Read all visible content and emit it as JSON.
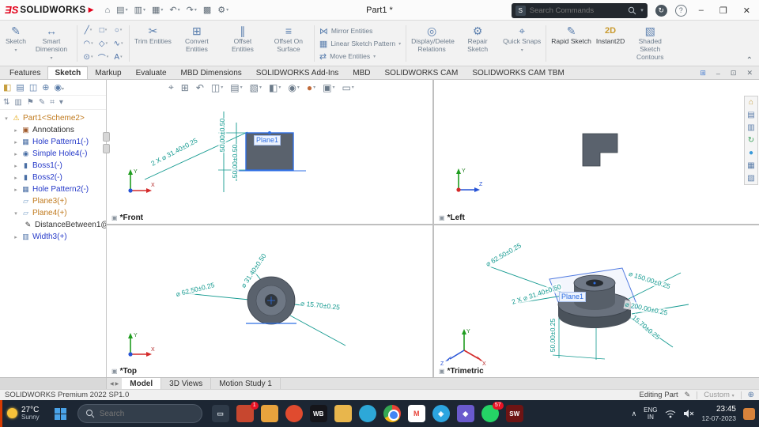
{
  "titlebar": {
    "logo_text": "SOLIDWORKS",
    "doc_title": "Part1 *",
    "search_placeholder": "Search Commands"
  },
  "ribbon": {
    "sketch": "Sketch",
    "smart_dimension": "Smart Dimension",
    "trim": "Trim Entities",
    "convert": "Convert Entities",
    "offset": "Offset Entities",
    "offset_surface": "Offset On Surface",
    "mirror": "Mirror Entities",
    "linear_pattern": "Linear Sketch Pattern",
    "move": "Move Entities",
    "relations": "Display/Delete Relations",
    "repair": "Repair Sketch",
    "quick_snaps": "Quick Snaps",
    "rapid_sketch": "Rapid Sketch",
    "instant2d": "Instant2D",
    "shaded_contours": "Shaded Sketch Contours"
  },
  "tabs": [
    "Features",
    "Sketch",
    "Markup",
    "Evaluate",
    "MBD Dimensions",
    "SOLIDWORKS Add-Ins",
    "MBD",
    "SOLIDWORKS CAM",
    "SOLIDWORKS CAM TBM"
  ],
  "tree": {
    "root": "Part1<Scheme2>",
    "items": [
      {
        "label": "Annotations"
      },
      {
        "label": "Hole Pattern1(-)"
      },
      {
        "label": "Simple Hole4(-)"
      },
      {
        "label": "Boss1(-)"
      },
      {
        "label": "Boss2(-)"
      },
      {
        "label": "Hole Pattern2(-)"
      },
      {
        "label": "Plane3(+)"
      },
      {
        "label": "Plane4(+)"
      },
      {
        "label": "DistanceBetween1@"
      },
      {
        "label": "Width3(+)"
      }
    ]
  },
  "viewports": {
    "front": {
      "label": "*Front",
      "plane": "Plane1",
      "dims": [
        "2 X ⌀ 31.40±0.25",
        "50.00±0.50",
        "50.00±0.50"
      ],
      "axes": [
        "Y",
        "X"
      ]
    },
    "left": {
      "label": "*Left",
      "axes": [
        "Y",
        "Z"
      ]
    },
    "top": {
      "label": "*Top",
      "dims": [
        "⌀ 62.50±0.25",
        "⌀ 31.40±0.50",
        "⌀ 15.70±0.25"
      ],
      "axes": [
        "Y",
        "X"
      ]
    },
    "trimetric": {
      "label": "*Trimetric",
      "plane": "Plane1",
      "dims": [
        "⌀ 62.50±0.25",
        "2 X ⌀ 31.40±0.50",
        "⌀ 150.00±0.25",
        "⌀ 200.00±0.25",
        "15.70±0.25",
        "50.00±0.25"
      ],
      "axes": [
        "Y",
        "X",
        "Z"
      ]
    }
  },
  "doc_tabs": [
    "Model",
    "3D Views",
    "Motion Study 1"
  ],
  "statusbar": {
    "product": "SOLIDWORKS Premium 2022 SP1.0",
    "mode": "Editing Part",
    "config": "Custom"
  },
  "taskbar": {
    "weather_temp": "27°C",
    "weather_cond": "Sunny",
    "search_placeholder": "Search",
    "lang_1": "ENG",
    "lang_2": "IN",
    "time": "23:45",
    "date": "12-07-2023",
    "apps": [
      {
        "name": "desktop-monitor"
      },
      {
        "name": "notifications",
        "badge": "1"
      },
      {
        "name": "files"
      },
      {
        "name": "opera"
      },
      {
        "name": "workbench",
        "text": "WB"
      },
      {
        "name": "folder"
      },
      {
        "name": "edge"
      },
      {
        "name": "chrome"
      },
      {
        "name": "gmail",
        "text": "M"
      },
      {
        "name": "telegram"
      },
      {
        "name": "discord"
      },
      {
        "name": "whatsapp",
        "badge": "57"
      },
      {
        "name": "solidworks",
        "text": "SW"
      }
    ]
  },
  "icons": {
    "home": "⌂",
    "open": "▤",
    "save": "▥",
    "print": "▦",
    "undo": "↶",
    "redo": "↷",
    "rebuild": "▩",
    "settings": "⚙",
    "search_s": "S",
    "help": "?",
    "sketch": "✎",
    "smart_dimension": "↔",
    "trim": "✂",
    "convert": "⊞",
    "offset": "∥",
    "offset_surface": "≡",
    "mirror": "⋈",
    "pattern": "▦",
    "move": "⇄",
    "relations": "◎",
    "repair": "⚙",
    "quick_snaps": "⌖",
    "rapid": "✎",
    "instant2d": "2D",
    "shaded": "▧",
    "view_cube": "▣",
    "pencil": "✎",
    "globe": "⊕",
    "warning": "⚠",
    "annotations": "▣",
    "hole_pattern": "▦",
    "simple_hole": "◉",
    "boss": "▮",
    "plane": "▱",
    "measure": "✎",
    "width": "▥"
  },
  "colors": {
    "accent_red": "#e2001a",
    "dimension_teal": "#12998f",
    "selection_blue": "#2f6fe4",
    "tree_blue": "#2438c8",
    "tree_orange": "#c07a1e",
    "taskbar_bg": "#1c2633",
    "part_gray": "#5a626d"
  }
}
